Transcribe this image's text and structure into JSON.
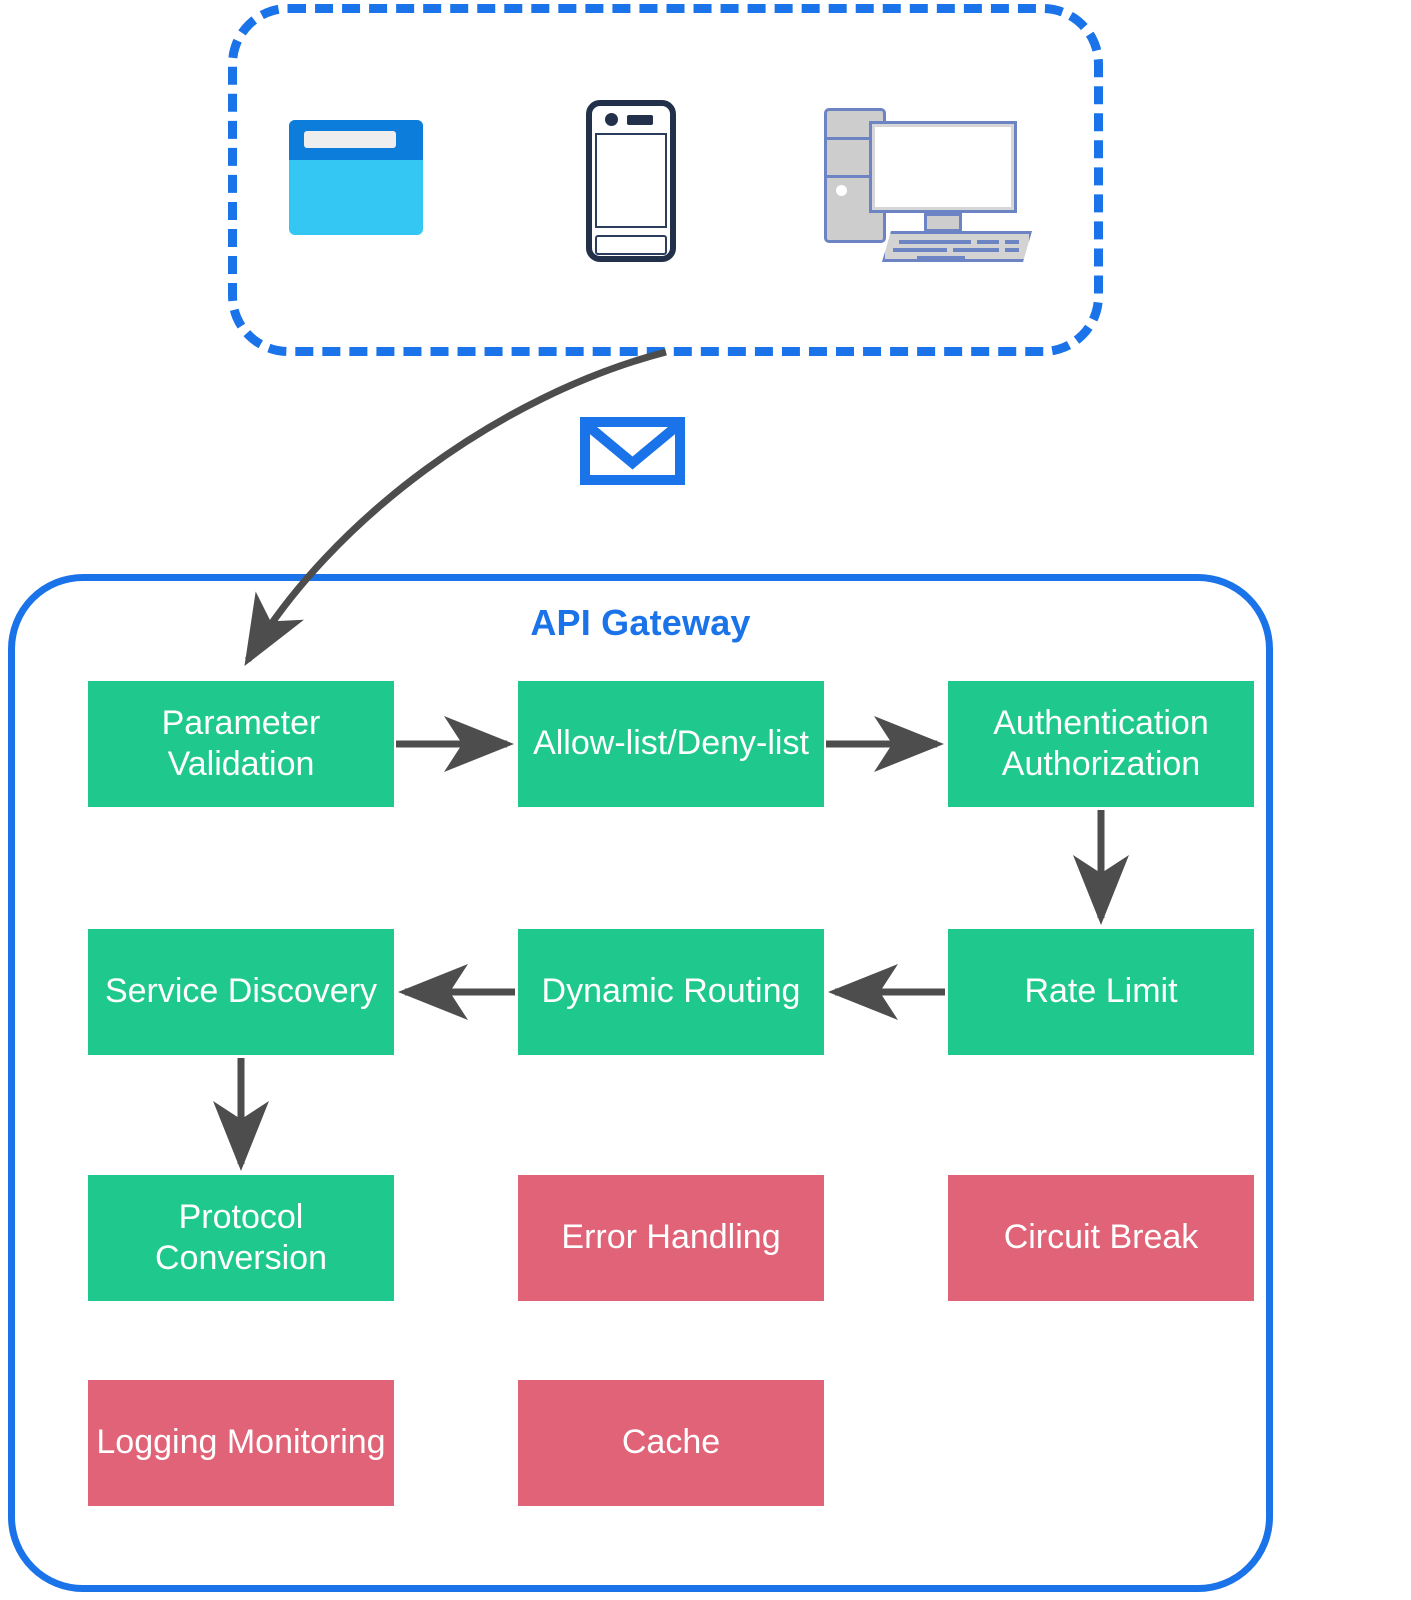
{
  "diagram": {
    "title": "API Gateway",
    "client_zone": {
      "label": "",
      "devices": [
        {
          "name": "browser-window-icon",
          "alt": "Browser window"
        },
        {
          "name": "smartphone-icon",
          "alt": "Smartphone"
        },
        {
          "name": "desktop-computer-icon",
          "alt": "Desktop computer"
        }
      ]
    },
    "request_icon": {
      "name": "envelope-icon",
      "alt": "Request message"
    },
    "colors": {
      "accent_blue": "#1a73e8",
      "green_box": "#1fc98d",
      "red_box": "#e06377",
      "arrow_gray": "#4d4d4d",
      "box_text": "#ffffff",
      "browser_cyan": "#34c7f4",
      "browser_titlebar": "#0d7ddb",
      "phone_outline": "#22304a",
      "desktop_gray": "#cdcdcd",
      "desktop_outline": "#6c84c4"
    },
    "boxes": {
      "parameter_validation": "Parameter Validation",
      "allow_deny_list": "Allow-list/Deny-list",
      "authentication_authorization": "Authentication Authorization",
      "service_discovery": "Service Discovery",
      "dynamic_routing": "Dynamic Routing",
      "rate_limit": "Rate Limit",
      "protocol_conversion": "Protocol Conversion",
      "error_handling": "Error Handling",
      "circuit_break": "Circuit Break",
      "logging_monitoring": "Logging Monitoring",
      "cache": "Cache"
    },
    "flow": [
      {
        "from": "client_zone",
        "to": "parameter_validation",
        "style": "curved"
      },
      {
        "from": "parameter_validation",
        "to": "allow_deny_list",
        "style": "right"
      },
      {
        "from": "allow_deny_list",
        "to": "authentication_authorization",
        "style": "right"
      },
      {
        "from": "authentication_authorization",
        "to": "rate_limit",
        "style": "down"
      },
      {
        "from": "rate_limit",
        "to": "dynamic_routing",
        "style": "left"
      },
      {
        "from": "dynamic_routing",
        "to": "service_discovery",
        "style": "left"
      },
      {
        "from": "service_discovery",
        "to": "protocol_conversion",
        "style": "down"
      }
    ],
    "unconnected_boxes": [
      "error_handling",
      "circuit_break",
      "logging_monitoring",
      "cache"
    ]
  }
}
